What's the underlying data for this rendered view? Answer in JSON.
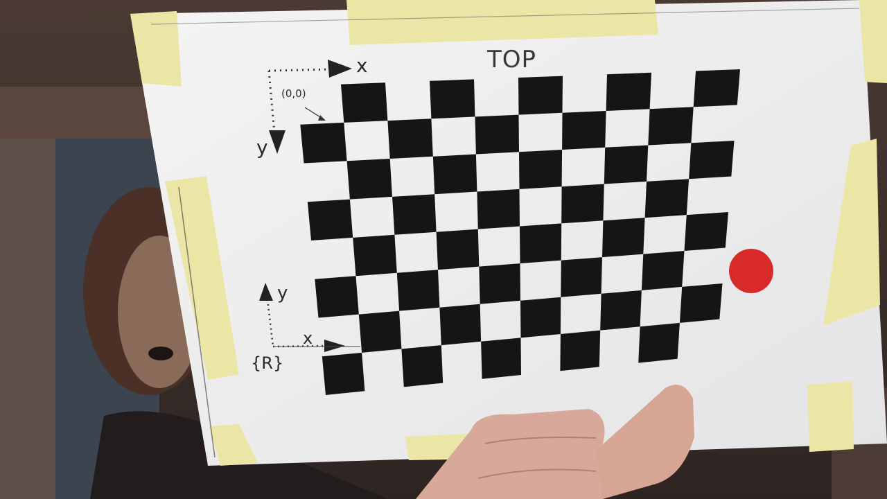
{
  "board": {
    "top_label": "TOP",
    "origin_label": "(0,0)",
    "axis_x_label": "x",
    "axis_y_label": "y",
    "ref_frame_label": "{R}",
    "ref_axis_x_label": "x",
    "ref_axis_y_label": "y"
  },
  "colors": {
    "board": "#f2f2f2",
    "tape": "#ece6a6",
    "square": "#151515",
    "marker": "#d92a2a",
    "background": "#3a302c"
  }
}
